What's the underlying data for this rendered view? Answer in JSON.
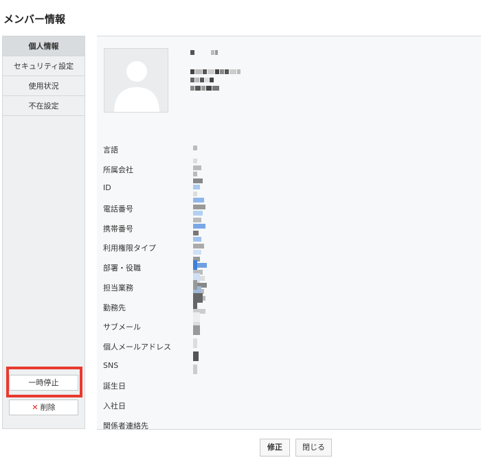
{
  "page": {
    "title": "メンバー情報"
  },
  "sidebar": {
    "items": [
      {
        "label": "個人情報"
      },
      {
        "label": "セキュリティ設定"
      },
      {
        "label": "使用状況"
      },
      {
        "label": "不在設定"
      }
    ],
    "pause_label": "一時停止",
    "delete_label": "削除",
    "delete_icon_glyph": "✕"
  },
  "profile": {
    "fields": [
      {
        "label": "言語"
      },
      {
        "label": "所属会社"
      },
      {
        "label": "ID"
      },
      {
        "label": "電話番号"
      },
      {
        "label": "携帯番号"
      },
      {
        "label": "利用権限タイプ"
      },
      {
        "label": "部署・役職"
      },
      {
        "label": "担当業務"
      },
      {
        "label": "勤務先"
      },
      {
        "label": "サブメール"
      },
      {
        "label": "個人メールアドレス"
      },
      {
        "label": "SNS"
      },
      {
        "label": "誕生日"
      },
      {
        "label": "入社日"
      },
      {
        "label": "関係者連絡先"
      }
    ]
  },
  "footer": {
    "edit_label": "修正",
    "close_label": "閉じる"
  },
  "colors": {
    "highlight": "#e83a2f",
    "link": "#3d7fd8",
    "delete": "#e0201a"
  }
}
